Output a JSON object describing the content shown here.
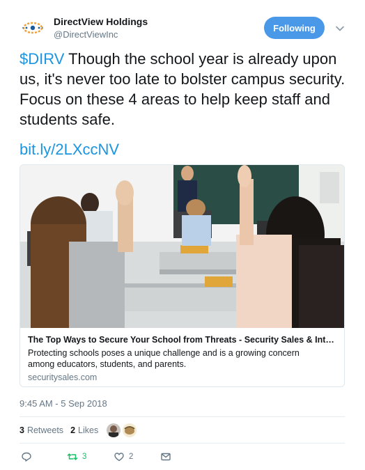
{
  "account": {
    "name": "DirectView Holdings",
    "handle": "@DirectViewInc"
  },
  "follow_button": {
    "label": "Following"
  },
  "tweet": {
    "cashtag": "$DIRV",
    "text": " Though the school year is already upon us, it's never too late to bolster campus security. Focus on these 4 areas to help keep staff and students safe.",
    "link": "bit.ly/2LXccNV"
  },
  "card": {
    "title": "The Top Ways to Secure Your School from Threats - Security Sales & Integrat...",
    "description": "Protecting schools poses a unique challenge and is a growing concern among educators, students, and parents.",
    "domain": "securitysales.com"
  },
  "timestamp": "9:45 AM - 5 Sep 2018",
  "stats": {
    "retweets_count": "3",
    "retweets_label": "Retweets",
    "likes_count": "2",
    "likes_label": "Likes"
  },
  "actions": {
    "reply_count": "",
    "retweet_count": "3",
    "like_count": "2"
  },
  "colors": {
    "accent": "#1b95e0",
    "follow_button": "#4a99e9",
    "retweet_green": "#17bf63",
    "muted": "#657786"
  },
  "icons": [
    "logo-icon",
    "chevron-down-icon",
    "reply-icon",
    "retweet-icon",
    "heart-icon",
    "message-icon"
  ]
}
